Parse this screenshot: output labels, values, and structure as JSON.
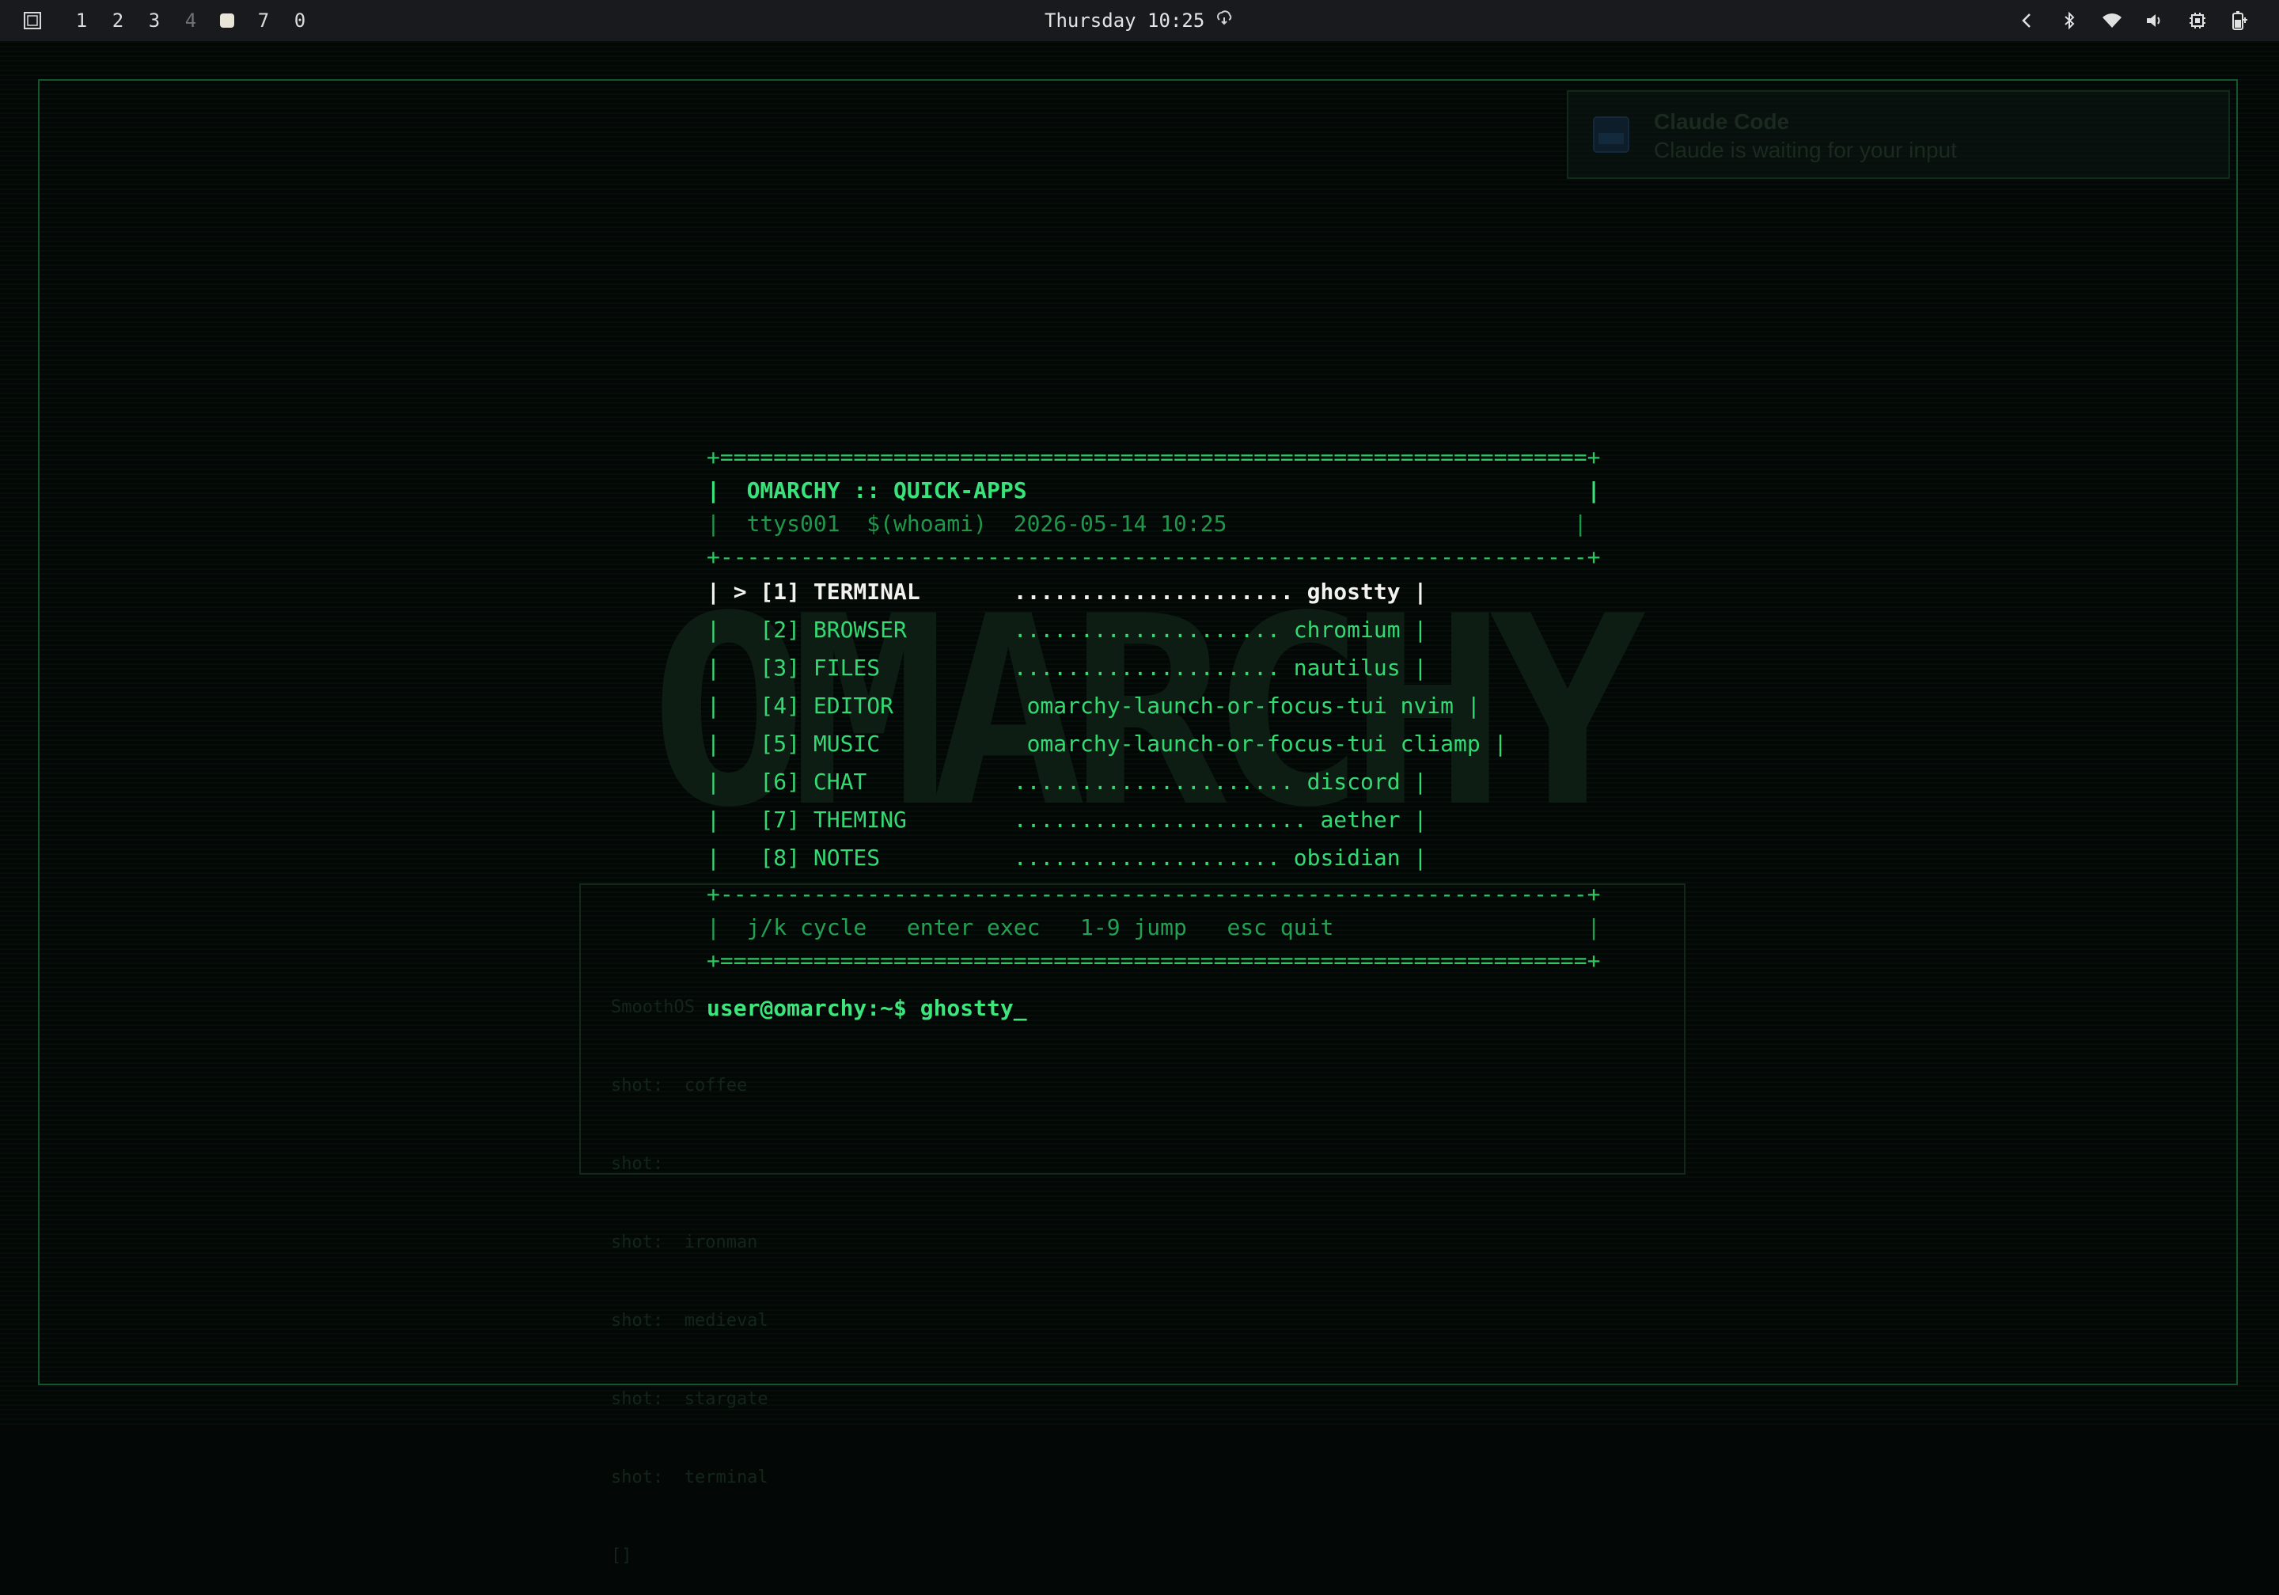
{
  "topbar": {
    "workspaces": [
      "1",
      "2",
      "3",
      "4",
      "7",
      "0"
    ],
    "clock": "Thursday 10:25",
    "tray_icons": [
      "chevron-left-icon",
      "bluetooth-icon",
      "wifi-icon",
      "volume-icon",
      "cpu-icon",
      "battery-icon"
    ]
  },
  "notification": {
    "title": "Claude Code",
    "body": "Claude is waiting for your input"
  },
  "background": {
    "ghost_word": "OMARCHY",
    "ghost_lines": [
      "SmoothOS",
      "shot:  coffee",
      "shot:  ",
      "shot:  ironman",
      "shot:  medieval",
      "shot:  stargate",
      "shot:  terminal",
      "[]"
    ]
  },
  "tui": {
    "rule_double": "+=================================================================+",
    "rule_single": "+-----------------------------------------------------------------+",
    "title": "|  OMARCHY :: QUICK-APPS                                          |",
    "subtitle": "|  ttys001  $(whoami)  2026-05-14 10:25                          |",
    "items": [
      "| > [1] TERMINAL       ..................... ghostty |",
      "|   [2] BROWSER        .................... chromium |",
      "|   [3] FILES          .................... nautilus |",
      "|   [4] EDITOR          omarchy-launch-or-focus-tui nvim |",
      "|   [5] MUSIC           omarchy-launch-or-focus-tui cliamp |",
      "|   [6] CHAT           ..................... discord |",
      "|   [7] THEMING        ...................... aether |",
      "|   [8] NOTES          .................... obsidian |"
    ],
    "footer": "|  j/k cycle   enter exec   1-9 jump   esc quit                   |",
    "prompt": "user@omarchy:~$ ghostty_"
  },
  "colors": {
    "accent": "#31d76e",
    "selected": "#f2f3ee",
    "frame": "#14552d",
    "background": "#030806"
  }
}
